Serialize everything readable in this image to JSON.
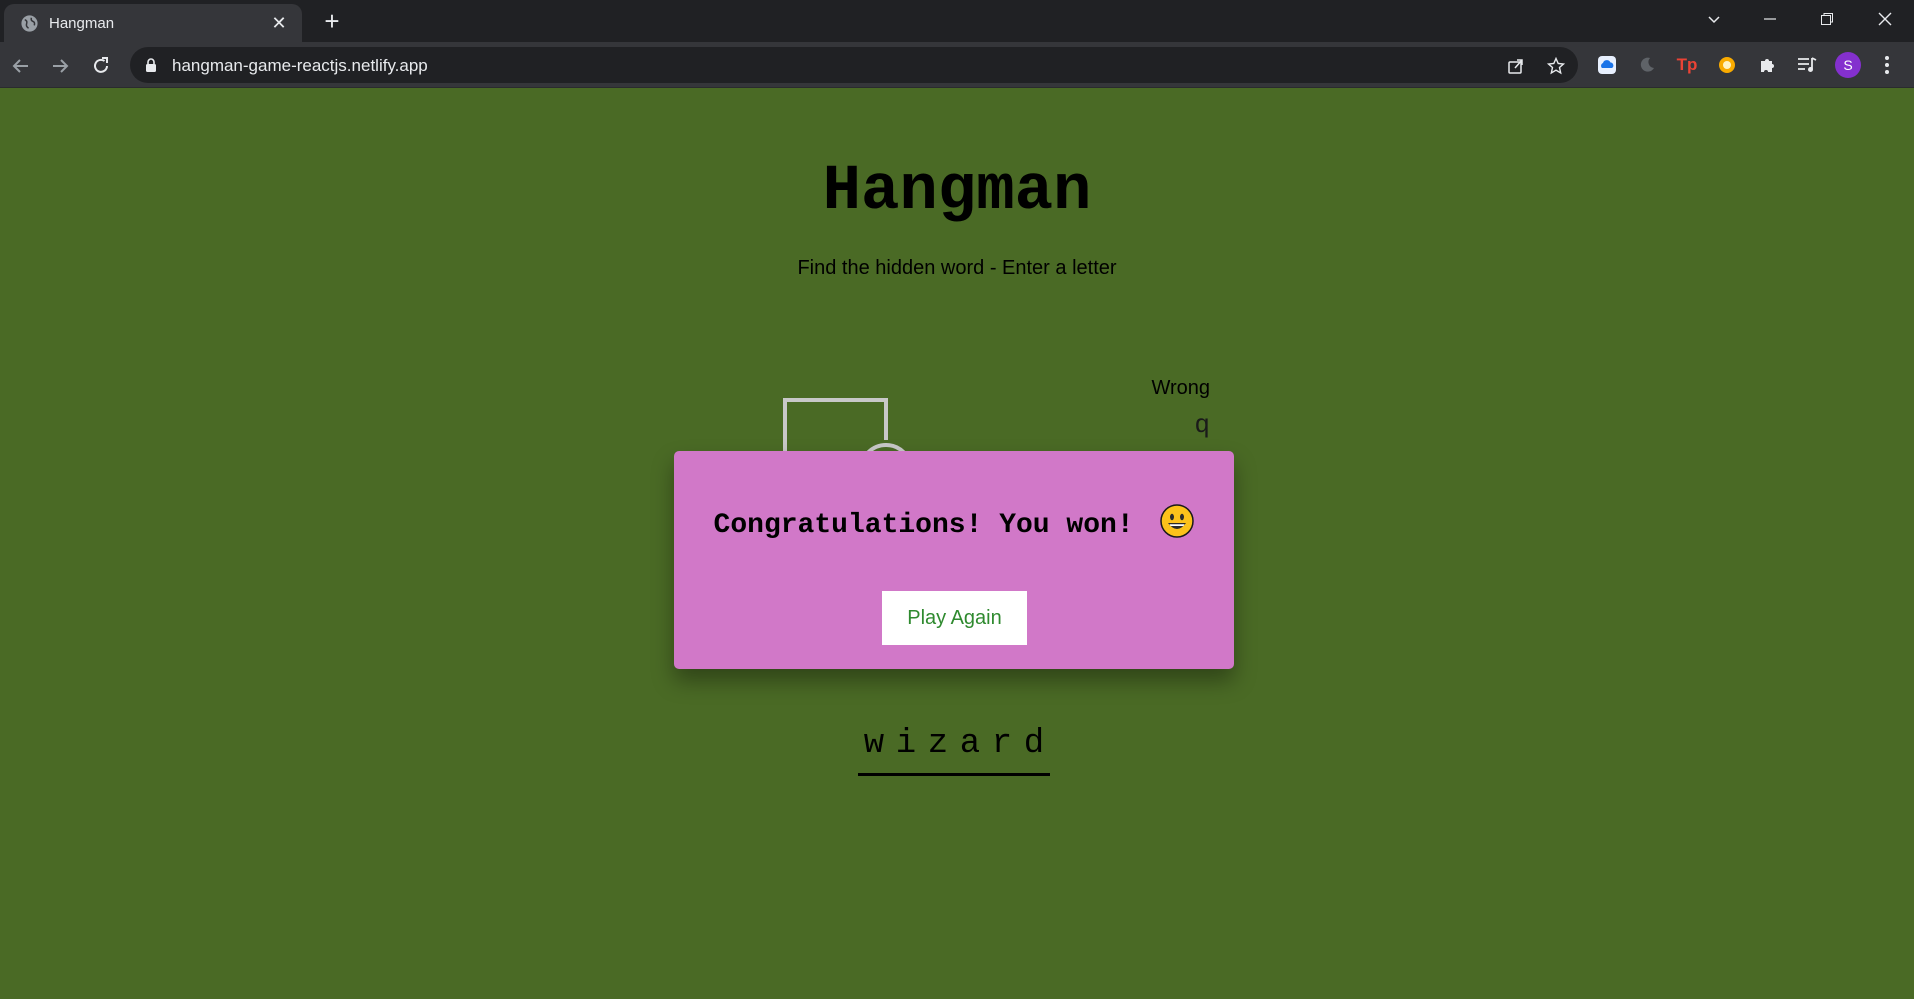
{
  "browser": {
    "tab_title": "Hangman",
    "url": "hangman-game-reactjs.netlify.app",
    "avatar_initial": "S"
  },
  "game": {
    "title": "Hangman",
    "subtitle": "Find the hidden word - Enter a letter",
    "wrong_label": "Wrong",
    "wrong_letters": [
      "q"
    ],
    "word_letters": [
      "w",
      "i",
      "z",
      "a",
      "r",
      "d"
    ]
  },
  "popup": {
    "message": "Congratulations! You won!",
    "emoji": "grinning-face-icon",
    "button_label": "Play Again"
  },
  "colors": {
    "page_bg": "#4a6a25",
    "popup_bg": "#d178c8",
    "button_text": "#2f8a2f",
    "gallows_stroke": "#c8c8c8"
  }
}
